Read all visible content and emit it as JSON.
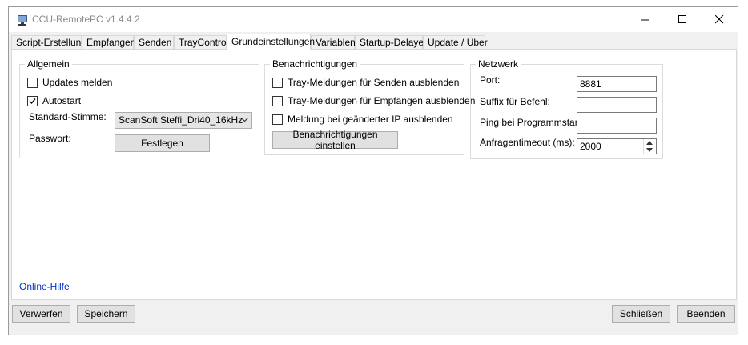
{
  "window": {
    "title": "CCU-RemotePC v1.4.4.2",
    "minimize": "—",
    "maximize": "☐",
    "close": "✕"
  },
  "tabs": [
    {
      "label": "Script-Erstellung"
    },
    {
      "label": "Empfangen"
    },
    {
      "label": "Senden"
    },
    {
      "label": "TrayControl"
    },
    {
      "label": "Grundeinstellungen"
    },
    {
      "label": "Variablen"
    },
    {
      "label": "Startup-Delayer"
    },
    {
      "label": "Update / Über"
    }
  ],
  "allgemein": {
    "title": "Allgemein",
    "updates_label": "Updates melden",
    "updates_checked": false,
    "autostart_label": "Autostart",
    "autostart_checked": true,
    "voice_label": "Standard-Stimme:",
    "voice_value": "ScanSoft Steffi_Dri40_16kHz",
    "password_label": "Passwort:",
    "password_button": "Festlegen"
  },
  "benachrichtigungen": {
    "title": "Benachrichtigungen",
    "item1": "Tray-Meldungen für Senden ausblenden",
    "item2": "Tray-Meldungen für Empfangen ausblenden",
    "item3": "Meldung bei geänderter IP ausblenden",
    "button": "Benachrichtigungen einstellen"
  },
  "netzwerk": {
    "title": "Netzwerk",
    "port_label": "Port:",
    "port_value": "8881",
    "suffix_label": "Suffix für Befehl:",
    "suffix_value": "",
    "ping_label": "Ping bei Programmstart:",
    "ping_value": "",
    "timeout_label": "Anfragentimeout (ms):",
    "timeout_value": "2000"
  },
  "help_link": "Online-Hilfe",
  "footer": {
    "discard": "Verwerfen",
    "save": "Speichern",
    "close": "Schließen",
    "quit": "Beenden"
  }
}
